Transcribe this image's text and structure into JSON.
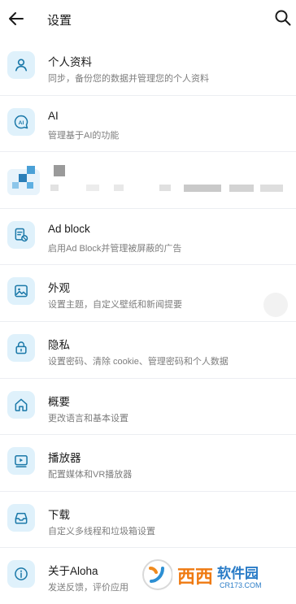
{
  "header": {
    "title": "设置",
    "back_icon": "back-arrow-icon",
    "search_icon": "search-icon"
  },
  "items": [
    {
      "icon": "person-icon",
      "title": "个人资料",
      "subtitle": "同步，备份您的数据并管理您的个人资料"
    },
    {
      "icon": "ai-chat-icon",
      "title": "AI",
      "subtitle": "管理基于AI的功能"
    },
    {
      "icon": "blurred-icon",
      "title": "",
      "subtitle": ""
    },
    {
      "icon": "ad-block-icon",
      "title": "Ad block",
      "subtitle": "启用Ad Block并管理被屏蔽的广告"
    },
    {
      "icon": "image-icon",
      "title": "外观",
      "subtitle": "设置主题，自定义壁纸和新闻提要"
    },
    {
      "icon": "lock-icon",
      "title": "隐私",
      "subtitle": "设置密码、清除 cookie、管理密码和个人数据"
    },
    {
      "icon": "home-icon",
      "title": "概要",
      "subtitle": "更改语言和基本设置"
    },
    {
      "icon": "player-icon",
      "title": "播放器",
      "subtitle": "配置媒体和VR播放器"
    },
    {
      "icon": "download-tray-icon",
      "title": "下载",
      "subtitle": "自定义多线程和垃圾箱设置"
    },
    {
      "icon": "info-icon",
      "title": "关于Aloha",
      "subtitle": "发送反馈，评价应用"
    }
  ],
  "watermark": {
    "text_cn": "西西软件园",
    "text_en": "CR173.COM"
  },
  "colors": {
    "icon_bg": "#dff1fb",
    "icon_fg": "#1a78a8",
    "divider": "#eceef2"
  }
}
